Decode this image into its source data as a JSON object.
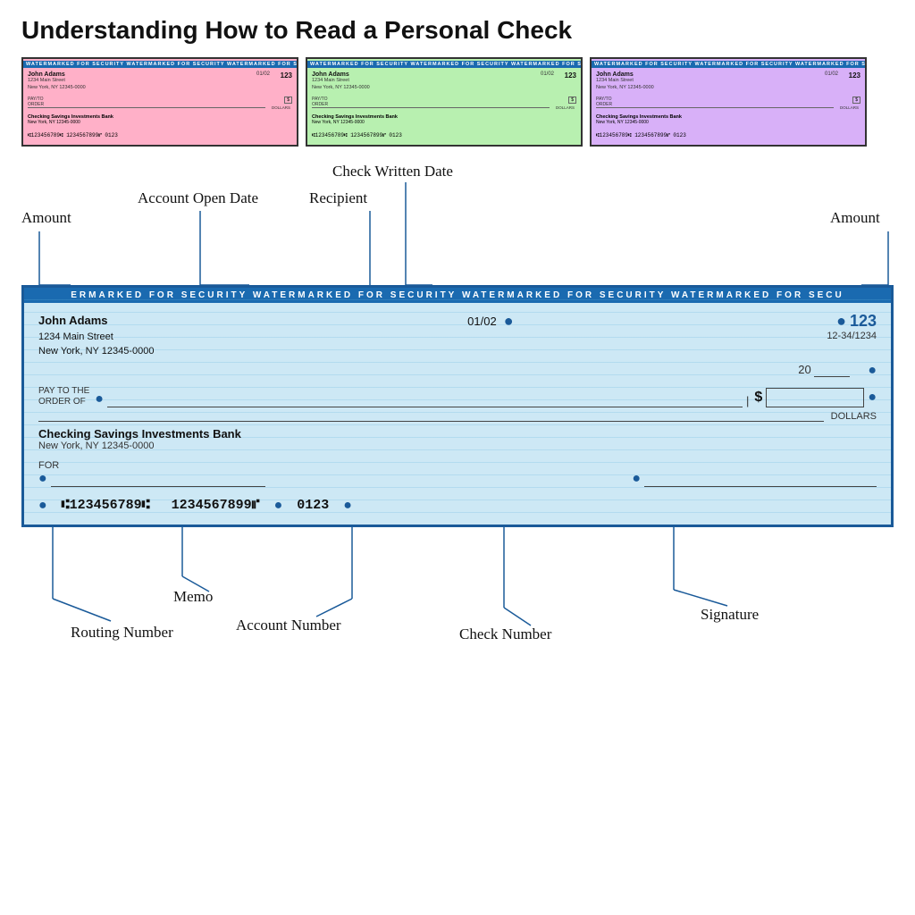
{
  "title": "Understanding How to Read a Personal Check",
  "small_checks": [
    {
      "color": "pink",
      "watermark": "WATERMARKED FOR SECURITY   WATERMARKED FOR SECURITY   WATERMARKED FOR SECURITY   WATERMARKED FOR SECU"
    },
    {
      "color": "green",
      "watermark": "WATERMARKED FOR SECURITY   WATERMARKED FOR SECURITY   WATERMARKED FOR SECURITY   WATERMARKED FOR SECU"
    },
    {
      "color": "purple",
      "watermark": "WATERMARKED FOR SECURITY   WATERMARKED FOR SECURITY   WATERMARKED FOR SECURITY   WATERMARKED FOR SECU"
    }
  ],
  "check": {
    "watermark_text": "ERMARKED FOR SECURITY          WATERMARKED FOR SECURITY          WATERMARKED FOR SECURITY          WATERMARKED FOR SECU",
    "name": "John Adams",
    "address_line1": "1234 Main Street",
    "address_line2": "New York, NY 12345-0000",
    "date": "01/02",
    "check_number": "123",
    "routing_fraction": "12-34/1234",
    "year_label": "20",
    "pay_to_label": "PAY TO THE\nORDER OF",
    "dollar_sign": "$",
    "dollars_label": "DOLLARS",
    "bank_name": "Checking Savings Investments Bank",
    "bank_address": "New York, NY 12345-0000",
    "for_label": "FOR",
    "micr_routing": "⑆123456789⑆",
    "micr_account": "1234567899⑈",
    "micr_check": "0123"
  },
  "annotations": {
    "account_open_date": "Account Open Date",
    "check_written_date": "Check Written Date",
    "recipient": "Recipient",
    "amount_left": "Amount",
    "amount_right": "Amount",
    "routing_number": "Routing Number",
    "account_number": "Account Number",
    "check_number": "Check Number",
    "memo": "Memo",
    "signature": "Signature"
  }
}
